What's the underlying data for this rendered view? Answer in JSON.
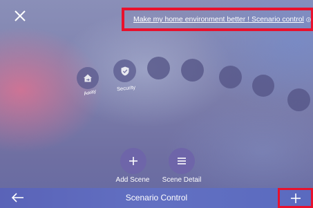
{
  "header": {
    "close_icon": "close-icon",
    "banner_text": "Make my home environment better ! Scenario control",
    "banner_icon": "circle-chevron-right-icon"
  },
  "scenes": [
    {
      "label": "Away",
      "icon": "home-away-icon"
    },
    {
      "label": "Security",
      "icon": "shield-check-icon"
    },
    {
      "label": "",
      "icon": ""
    },
    {
      "label": "",
      "icon": ""
    },
    {
      "label": "",
      "icon": ""
    },
    {
      "label": "",
      "icon": ""
    },
    {
      "label": "",
      "icon": ""
    }
  ],
  "actions": {
    "add_scene_label": "Add Scene",
    "scene_detail_label": "Scene Detail"
  },
  "bottom_bar": {
    "title": "Scenario Control",
    "back_icon": "arrow-left-icon",
    "add_icon": "plus-icon"
  },
  "colors": {
    "highlight": "#e8112d",
    "bar": "#5f6bbf"
  }
}
